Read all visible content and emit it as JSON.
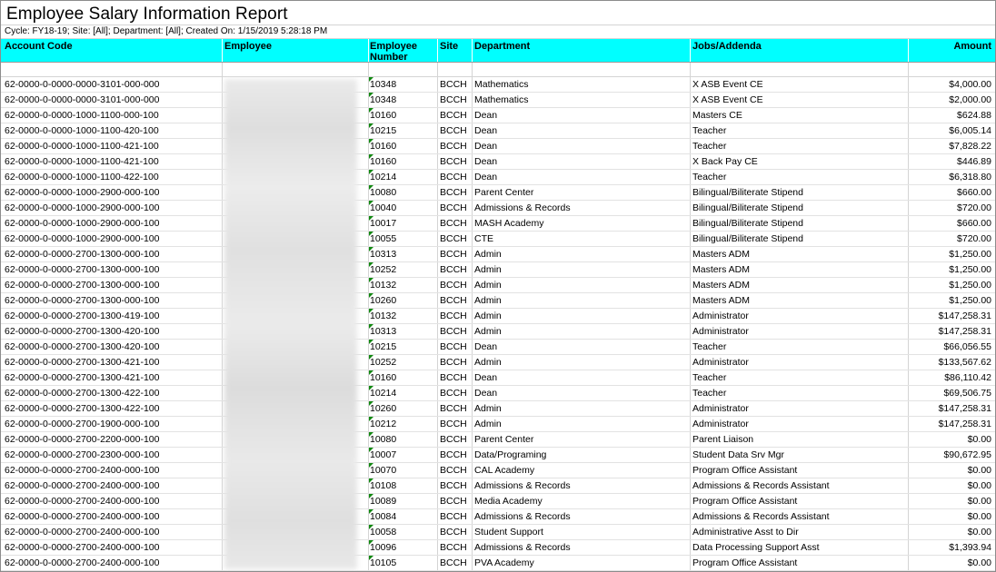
{
  "report": {
    "title": "Employee Salary Information Report",
    "subtitle": "Cycle: FY18-19; Site: [All]; Department: [All]; Created On: 1/15/2019 5:28:18 PM"
  },
  "columns": {
    "account_code": "Account Code",
    "employee": "Employee",
    "employee_number": "Employee Number",
    "site": "Site",
    "department": "Department",
    "jobs": "Jobs/Addenda",
    "amount": "Amount"
  },
  "colors": {
    "header_bg": "#00ffff",
    "grid": "#d4d4d4",
    "number_flag": "#118811"
  },
  "rows": [
    {
      "account": "62-0000-0-0000-0000-3101-000-000",
      "num": "10348",
      "site": "BCCH",
      "dept": "Mathematics",
      "job": "X ASB Event CE",
      "amount": "$4,000.00"
    },
    {
      "account": "62-0000-0-0000-0000-3101-000-000",
      "num": "10348",
      "site": "BCCH",
      "dept": "Mathematics",
      "job": "X ASB Event CE",
      "amount": "$2,000.00"
    },
    {
      "account": "62-0000-0-0000-1000-1100-000-100",
      "num": "10160",
      "site": "BCCH",
      "dept": "Dean",
      "job": "Masters CE",
      "amount": "$624.88"
    },
    {
      "account": "62-0000-0-0000-1000-1100-420-100",
      "num": "10215",
      "site": "BCCH",
      "dept": "Dean",
      "job": "Teacher",
      "amount": "$6,005.14"
    },
    {
      "account": "62-0000-0-0000-1000-1100-421-100",
      "num": "10160",
      "site": "BCCH",
      "dept": "Dean",
      "job": "Teacher",
      "amount": "$7,828.22"
    },
    {
      "account": "62-0000-0-0000-1000-1100-421-100",
      "num": "10160",
      "site": "BCCH",
      "dept": "Dean",
      "job": "X Back Pay CE",
      "amount": "$446.89"
    },
    {
      "account": "62-0000-0-0000-1000-1100-422-100",
      "num": "10214",
      "site": "BCCH",
      "dept": "Dean",
      "job": "Teacher",
      "amount": "$6,318.80"
    },
    {
      "account": "62-0000-0-0000-1000-2900-000-100",
      "num": "10080",
      "site": "BCCH",
      "dept": "Parent Center",
      "job": "Bilingual/Biliterate Stipend",
      "amount": "$660.00"
    },
    {
      "account": "62-0000-0-0000-1000-2900-000-100",
      "num": "10040",
      "site": "BCCH",
      "dept": "Admissions & Records",
      "job": "Bilingual/Biliterate Stipend",
      "amount": "$720.00"
    },
    {
      "account": "62-0000-0-0000-1000-2900-000-100",
      "num": "10017",
      "site": "BCCH",
      "dept": "MASH Academy",
      "job": "Bilingual/Biliterate Stipend",
      "amount": "$660.00"
    },
    {
      "account": "62-0000-0-0000-1000-2900-000-100",
      "num": "10055",
      "site": "BCCH",
      "dept": "CTE",
      "job": "Bilingual/Biliterate Stipend",
      "amount": "$720.00"
    },
    {
      "account": "62-0000-0-0000-2700-1300-000-100",
      "num": "10313",
      "site": "BCCH",
      "dept": "Admin",
      "job": "Masters ADM",
      "amount": "$1,250.00"
    },
    {
      "account": "62-0000-0-0000-2700-1300-000-100",
      "num": "10252",
      "site": "BCCH",
      "dept": "Admin",
      "job": "Masters ADM",
      "amount": "$1,250.00"
    },
    {
      "account": "62-0000-0-0000-2700-1300-000-100",
      "num": "10132",
      "site": "BCCH",
      "dept": "Admin",
      "job": "Masters ADM",
      "amount": "$1,250.00"
    },
    {
      "account": "62-0000-0-0000-2700-1300-000-100",
      "num": "10260",
      "site": "BCCH",
      "dept": "Admin",
      "job": "Masters ADM",
      "amount": "$1,250.00"
    },
    {
      "account": "62-0000-0-0000-2700-1300-419-100",
      "num": "10132",
      "site": "BCCH",
      "dept": "Admin",
      "job": "Administrator",
      "amount": "$147,258.31"
    },
    {
      "account": "62-0000-0-0000-2700-1300-420-100",
      "num": "10313",
      "site": "BCCH",
      "dept": "Admin",
      "job": "Administrator",
      "amount": "$147,258.31"
    },
    {
      "account": "62-0000-0-0000-2700-1300-420-100",
      "num": "10215",
      "site": "BCCH",
      "dept": "Dean",
      "job": "Teacher",
      "amount": "$66,056.55"
    },
    {
      "account": "62-0000-0-0000-2700-1300-421-100",
      "num": "10252",
      "site": "BCCH",
      "dept": "Admin",
      "job": "Administrator",
      "amount": "$133,567.62"
    },
    {
      "account": "62-0000-0-0000-2700-1300-421-100",
      "num": "10160",
      "site": "BCCH",
      "dept": "Dean",
      "job": "Teacher",
      "amount": "$86,110.42"
    },
    {
      "account": "62-0000-0-0000-2700-1300-422-100",
      "num": "10214",
      "site": "BCCH",
      "dept": "Dean",
      "job": "Teacher",
      "amount": "$69,506.75"
    },
    {
      "account": "62-0000-0-0000-2700-1300-422-100",
      "num": "10260",
      "site": "BCCH",
      "dept": "Admin",
      "job": "Administrator",
      "amount": "$147,258.31"
    },
    {
      "account": "62-0000-0-0000-2700-1900-000-100",
      "num": "10212",
      "site": "BCCH",
      "dept": "Admin",
      "job": "Administrator",
      "amount": "$147,258.31"
    },
    {
      "account": "62-0000-0-0000-2700-2200-000-100",
      "num": "10080",
      "site": "BCCH",
      "dept": "Parent Center",
      "job": "Parent Liaison",
      "amount": "$0.00"
    },
    {
      "account": "62-0000-0-0000-2700-2300-000-100",
      "num": "10007",
      "site": "BCCH",
      "dept": "Data/Programing",
      "job": "Student Data Srv Mgr",
      "amount": "$90,672.95"
    },
    {
      "account": "62-0000-0-0000-2700-2400-000-100",
      "num": "10070",
      "site": "BCCH",
      "dept": "CAL Academy",
      "job": "Program Office Assistant",
      "amount": "$0.00"
    },
    {
      "account": "62-0000-0-0000-2700-2400-000-100",
      "num": "10108",
      "site": "BCCH",
      "dept": "Admissions & Records",
      "job": "Admissions & Records Assistant",
      "amount": "$0.00"
    },
    {
      "account": "62-0000-0-0000-2700-2400-000-100",
      "num": "10089",
      "site": "BCCH",
      "dept": "Media Academy",
      "job": "Program Office Assistant",
      "amount": "$0.00"
    },
    {
      "account": "62-0000-0-0000-2700-2400-000-100",
      "num": "10084",
      "site": "BCCH",
      "dept": "Admissions & Records",
      "job": "Admissions & Records Assistant",
      "amount": "$0.00"
    },
    {
      "account": "62-0000-0-0000-2700-2400-000-100",
      "num": "10058",
      "site": "BCCH",
      "dept": "Student Support",
      "job": "Administrative Asst to Dir",
      "amount": "$0.00"
    },
    {
      "account": "62-0000-0-0000-2700-2400-000-100",
      "num": "10096",
      "site": "BCCH",
      "dept": "Admissions & Records",
      "job": "Data Processing Support Asst",
      "amount": "$1,393.94"
    },
    {
      "account": "62-0000-0-0000-2700-2400-000-100",
      "num": "10105",
      "site": "BCCH",
      "dept": "PVA Academy",
      "job": "Program Office Assistant",
      "amount": "$0.00"
    }
  ]
}
